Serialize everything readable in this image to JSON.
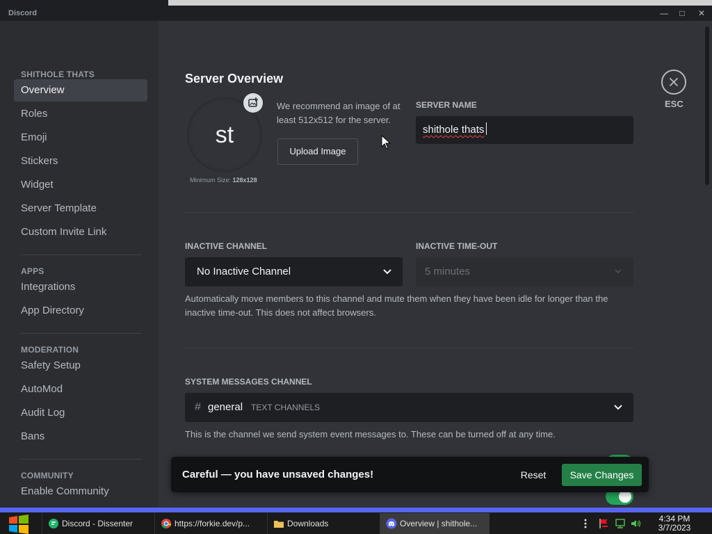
{
  "window": {
    "title": "Discord"
  },
  "sidebar": {
    "server_heading": "SHITHOLE THATS",
    "server_items": [
      "Overview",
      "Roles",
      "Emoji",
      "Stickers",
      "Widget",
      "Server Template",
      "Custom Invite Link"
    ],
    "apps_heading": "APPS",
    "apps_items": [
      "Integrations",
      "App Directory"
    ],
    "moderation_heading": "MODERATION",
    "moderation_items": [
      "Safety Setup",
      "AutoMod",
      "Audit Log",
      "Bans"
    ],
    "community_heading": "COMMUNITY",
    "community_items": [
      "Enable Community"
    ]
  },
  "overview": {
    "title": "Server Overview",
    "avatar_initials": "st",
    "min_size_label": "Minimum Size:",
    "min_size_value": "128x128",
    "recommend_text": "We recommend an image of at least 512x512 for the server.",
    "upload_button": "Upload Image",
    "server_name_label": "SERVER NAME",
    "server_name_value": "shithole thats",
    "inactive_channel_label": "INACTIVE CHANNEL",
    "inactive_channel_value": "No Inactive Channel",
    "inactive_timeout_label": "INACTIVE TIME-OUT",
    "inactive_timeout_value": "5 minutes",
    "inactive_help": "Automatically move members to this channel and mute them when they have been idle for longer than the inactive time-out. This does not affect browsers.",
    "system_channel_label": "SYSTEM MESSAGES CHANNEL",
    "system_channel_hash": "#",
    "system_channel_value": "general",
    "system_channel_category": "TEXT CHANNELS",
    "system_help": "This is the channel we send system event messages to. These can be turned off at any time.",
    "welcome_toggle_on": true
  },
  "close": {
    "esc_label": "ESC"
  },
  "unsaved": {
    "message": "Careful — you have unsaved changes!",
    "reset": "Reset",
    "save": "Save Changes"
  },
  "taskbar": {
    "tasks": [
      "Discord - Dissenter",
      "https://forkie.dev/p...",
      "Downloads",
      "Overview | shithole..."
    ],
    "time": "4:34 PM",
    "date": "3/7/2023"
  },
  "colors": {
    "accent": "#5865f2",
    "save_green": "#248046",
    "toggle_green": "#23a559",
    "background": "#313338",
    "sidebar": "#2b2d31"
  }
}
